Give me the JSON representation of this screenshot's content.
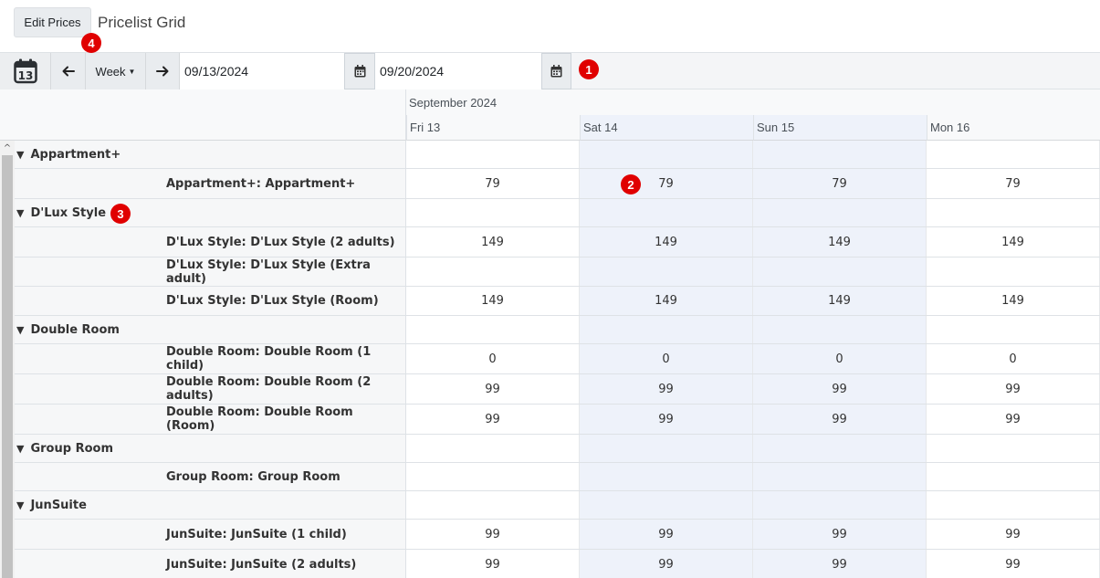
{
  "header": {
    "edit_button_label": "Edit Prices",
    "title": "Pricelist Grid"
  },
  "toolbar": {
    "today_icon": "calendar-today-icon",
    "prev_icon": "arrow-left-icon",
    "range_label": "Week",
    "next_icon": "arrow-right-icon",
    "start_date": "09/13/2024",
    "end_date": "09/20/2024"
  },
  "badges": [
    "1",
    "2",
    "3",
    "4"
  ],
  "grid": {
    "month": "September 2024",
    "days": [
      {
        "label": "Fri 13",
        "weekend": false
      },
      {
        "label": "Sat 14",
        "weekend": true
      },
      {
        "label": "Sun 15",
        "weekend": true
      },
      {
        "label": "Mon 16",
        "weekend": false
      }
    ],
    "rows": [
      {
        "type": "group",
        "label": "Appartment+",
        "values": [
          "",
          "",
          "",
          ""
        ]
      },
      {
        "type": "item",
        "label": "Appartment+: Appartment+",
        "values": [
          "79",
          "79",
          "79",
          "79"
        ]
      },
      {
        "type": "group",
        "label": "D'Lux Style",
        "values": [
          "",
          "",
          "",
          ""
        ]
      },
      {
        "type": "item",
        "label": "D'Lux Style: D'Lux Style (2 adults)",
        "values": [
          "149",
          "149",
          "149",
          "149"
        ]
      },
      {
        "type": "item",
        "label": "D'Lux Style: D'Lux Style (Extra adult)",
        "values": [
          "",
          "",
          "",
          ""
        ]
      },
      {
        "type": "item",
        "label": "D'Lux Style: D'Lux Style (Room)",
        "values": [
          "149",
          "149",
          "149",
          "149"
        ]
      },
      {
        "type": "group",
        "label": "Double Room",
        "values": [
          "",
          "",
          "",
          ""
        ]
      },
      {
        "type": "item",
        "label": "Double Room: Double Room (1 child)",
        "values": [
          "0",
          "0",
          "0",
          "0"
        ]
      },
      {
        "type": "item",
        "label": "Double Room: Double Room (2 adults)",
        "values": [
          "99",
          "99",
          "99",
          "99"
        ]
      },
      {
        "type": "item",
        "label": "Double Room: Double Room (Room)",
        "values": [
          "99",
          "99",
          "99",
          "99"
        ]
      },
      {
        "type": "group",
        "label": "Group Room",
        "values": [
          "",
          "",
          "",
          ""
        ]
      },
      {
        "type": "item",
        "label": "Group Room: Group Room",
        "values": [
          "",
          "",
          "",
          ""
        ]
      },
      {
        "type": "group",
        "label": "JunSuite",
        "values": [
          "",
          "",
          "",
          ""
        ]
      },
      {
        "type": "item",
        "label": "JunSuite: JunSuite (1 child)",
        "values": [
          "99",
          "99",
          "99",
          "99"
        ]
      },
      {
        "type": "item",
        "label": "JunSuite: JunSuite (2 adults)",
        "values": [
          "99",
          "99",
          "99",
          "99"
        ]
      }
    ]
  }
}
